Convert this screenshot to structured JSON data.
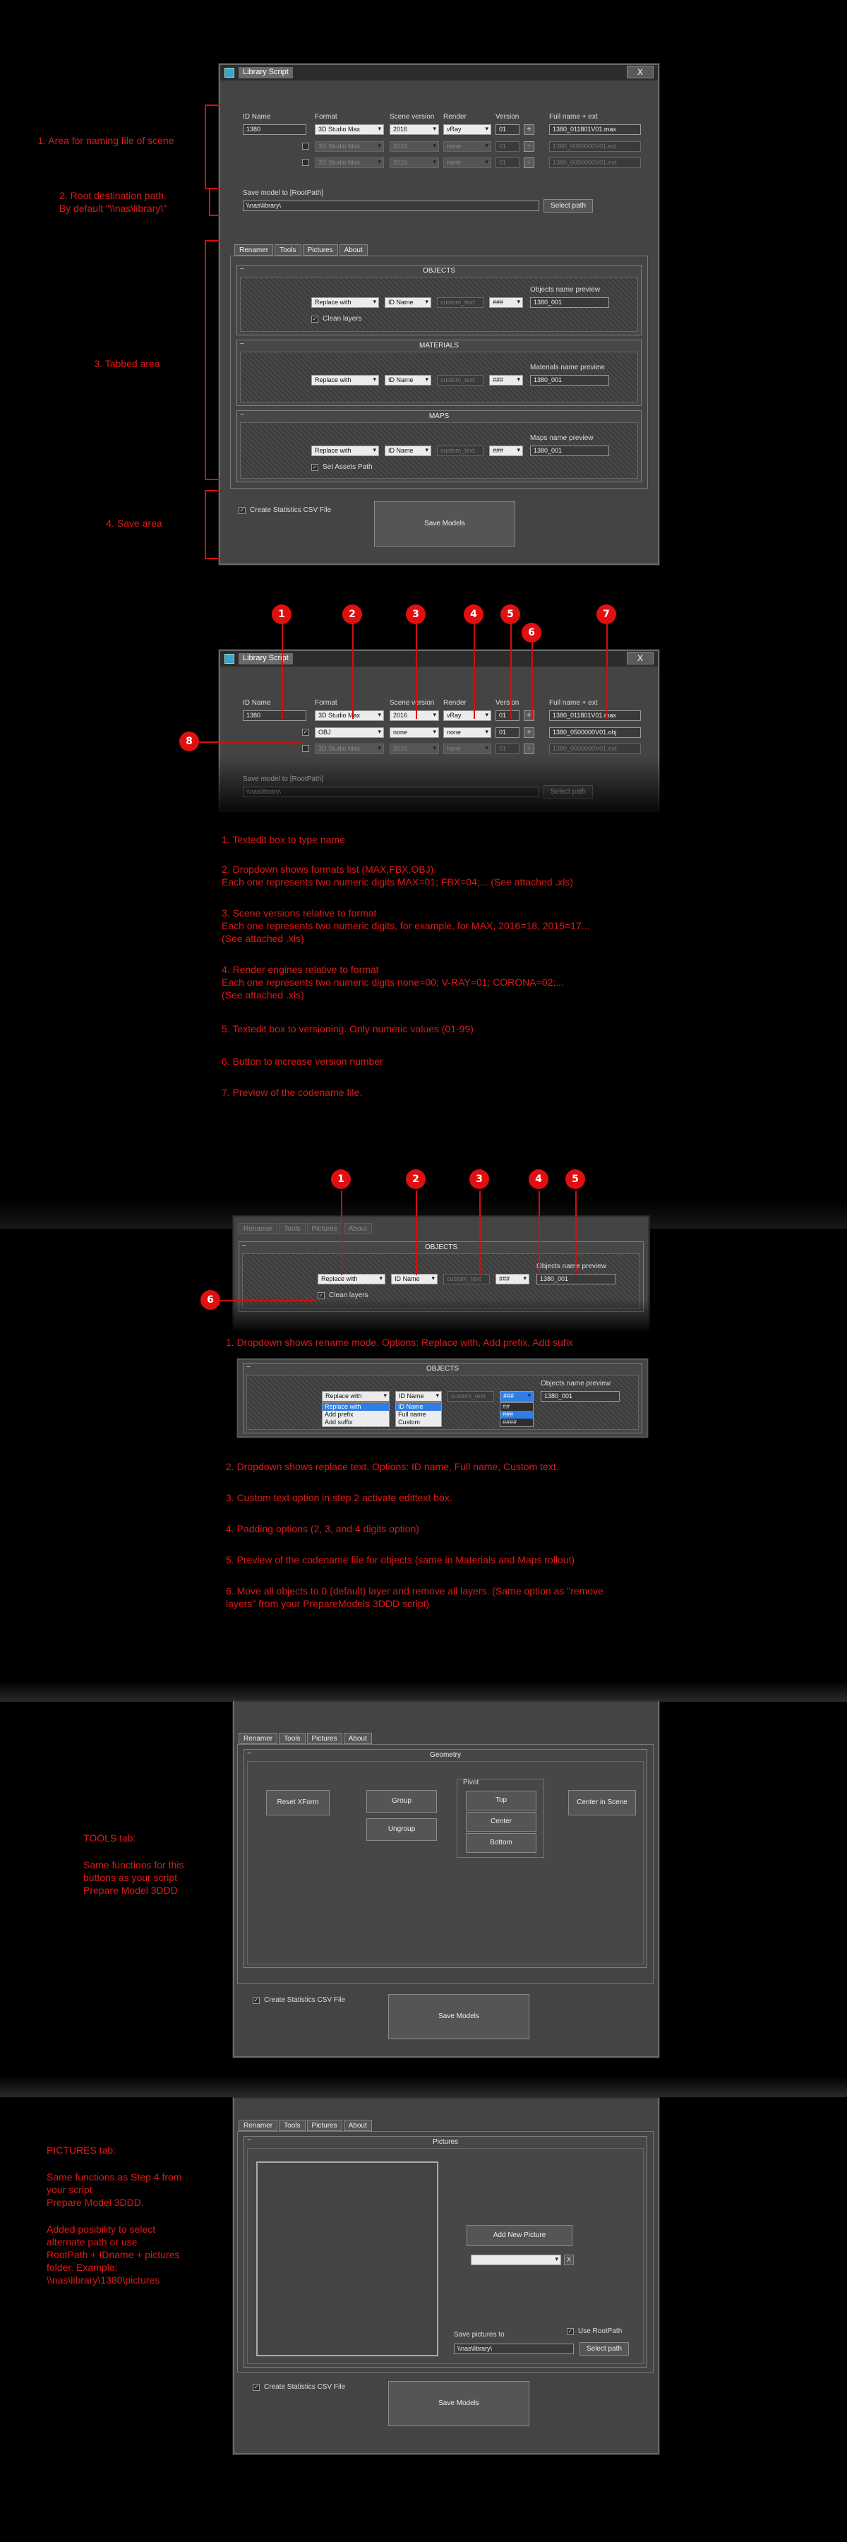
{
  "app": {
    "title": "Library Script",
    "close": "X"
  },
  "naming": {
    "id_label": "ID Name",
    "format_label": "Format",
    "scene_version_label": "Scene version",
    "render_label": "Render",
    "version_label": "Version",
    "fullname_label": "Full name + ext",
    "id_value": "1380",
    "rows": [
      {
        "format": "3D Studio Max",
        "scene": "2016",
        "render": "vRay",
        "version": "01",
        "fullname": "1380_011801V01.max"
      },
      {
        "format": "3D Studio Max",
        "scene": "2016",
        "render": "none",
        "version": "01",
        "fullname": "1380_0000000V01.ext"
      },
      {
        "format": "3D Studio Max",
        "scene": "2016",
        "render": "none",
        "version": "01",
        "fullname": "1380_0000000V01.ext"
      }
    ],
    "plus": "+"
  },
  "naming2": {
    "rows": [
      {
        "format": "3D Studio Max",
        "scene": "2016",
        "render": "vRay",
        "version": "01",
        "fullname": "1380_011801V01.max"
      },
      {
        "format": "OBJ",
        "scene": "none",
        "render": "none",
        "version": "01",
        "fullname": "1380_0500000V01.obj"
      },
      {
        "format": "3D Studio Max",
        "scene": "2016",
        "render": "none",
        "version": "01",
        "fullname": "1380_0000000V01.ext"
      }
    ]
  },
  "save_path": {
    "label": "Save model to [RootPath]",
    "value": "\\\\nas\\library\\",
    "button": "Select path"
  },
  "tabs": [
    "Renamer",
    "Tools",
    "Pictures",
    "About"
  ],
  "renamer": {
    "objects_title": "OBJECTS",
    "materials_title": "MATERIALS",
    "maps_title": "MAPS",
    "mode": "Replace with",
    "idname": "ID Name",
    "custom": "custom_text",
    "padding": "###",
    "objects_preview_label": "Objects name preview",
    "materials_preview_label": "Materials name preview",
    "maps_preview_label": "Maps name preview",
    "preview_value": "1380_001",
    "clean_layers": "Clean layers",
    "set_assets": "Set Assets Path",
    "minus": "-",
    "mode_options": [
      "Replace with",
      "Add prefix",
      "Add suffix"
    ],
    "idname_options": [
      "ID Name",
      "Full name",
      "Custom"
    ],
    "padding_options": [
      "##",
      "###",
      "####"
    ]
  },
  "save_area": {
    "csv": "Create Statistics CSV File",
    "save": "Save Models"
  },
  "tools": {
    "geometry_title": "Geometry",
    "reset_xform": "Reset XForm",
    "group": "Group",
    "ungroup": "Ungroup",
    "pivot_label": "Pivot",
    "top": "Top",
    "center": "Center",
    "bottom": "Bottom",
    "center_in_scene": "Center in Scene"
  },
  "pictures": {
    "title": "Pictures",
    "add_new": "Add New Picture",
    "x": "X",
    "save_pictures_to": "Save pictures to",
    "use_rootpath": "Use RootPath",
    "path_value": "\\\\nas\\library\\",
    "select_path": "Select path"
  },
  "annotations": {
    "a1": "1. Area for naming file of scene",
    "a2_l1": "2. Root destination path.",
    "a2_l2": "By default \"\\\\nas\\library\\\"",
    "a3": "3. Tabbed area",
    "a4": "4. Save area",
    "n1": "1",
    "n2": "2",
    "n3": "3",
    "n4": "4",
    "n5": "5",
    "n6": "6",
    "n7": "7",
    "n8": "8",
    "d1": "1. Textedit box to type name",
    "d2_l1": "2. Dropdown shows formats list (MAX,FBX,OBJ).",
    "d2_l2": "Each one represents two numeric digits MAX=01; FBX=04;... (See attached .xls)",
    "d3_l1": "3. Scene versions relative to format",
    "d3_l2": "Each one represents two numeric digits, for example, for MAX, 2016=18, 2015=17...",
    "d3_l3": "(See attached .xls)",
    "d4_l1": "4. Render engines relative to format",
    "d4_l2": "Each one represents two numeric digits none=00; V-RAY=01; CORONA=02;...",
    "d4_l3": "(See attached .xls)",
    "d5": "5. Textedit box to versioning. Only numeric values (01-99)",
    "d6": "6. Button to increase version number",
    "d7": "7. Preview of the codename file.",
    "r1": "1. Dropdown shows rename mode. Options: Replace with, Add prefix, Add sufix",
    "r2": "2. Dropdown shows replace text. Options: ID name, Full name, Custom text.",
    "r3": "3. Custom text option in step 2 activate edittext box.",
    "r4": "4. Padding options (2, 3, and 4 digits option)",
    "r5": "5. Preview of the codename file for objects (same in Materials and Maps rollout)",
    "r6_l1": "6. Move all objects to 0 (default) layer and remove all layers. (Same option as \"remove",
    "r6_l2": "layers\" from your PrepareModels 3DDD script)",
    "tools_l1": "TOOLS tab:",
    "tools_l2": "Same functions for this",
    "tools_l3": "buttons as your script",
    "tools_l4": "Prepare Model 3DDD",
    "pic_l1": "PICTURES tab:",
    "pic_l2": "Same functions as Step 4 from",
    "pic_l3": "your script",
    "pic_l4": "Prepare Model 3DDD.",
    "pic_l5": "Added posibility to select",
    "pic_l6": "alternate path or use",
    "pic_l7": "RootPath + IDname + pictures",
    "pic_l8": "folder. Example:",
    "pic_l9": "\\\\nas\\library\\1380\\pictures"
  },
  "colors": {
    "annotation_red": "#e01818",
    "window_bg": "#444444",
    "highlight_blue": "#2f7ee6"
  }
}
